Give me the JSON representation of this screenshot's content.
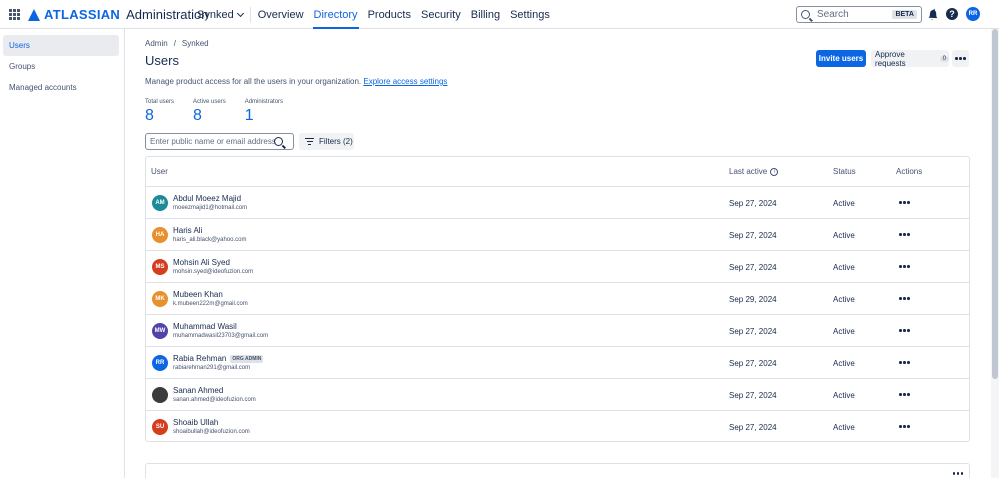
{
  "header": {
    "brand": "ATLASSIAN",
    "product": "Administration",
    "org": "Synked",
    "nav": [
      "Overview",
      "Directory",
      "Products",
      "Security",
      "Billing",
      "Settings"
    ],
    "active_nav": "Directory",
    "search_placeholder": "Search",
    "search_badge": "BETA",
    "profile_initials": "RR"
  },
  "sidebar": {
    "items": [
      {
        "label": "Users",
        "active": true
      },
      {
        "label": "Groups",
        "active": false
      },
      {
        "label": "Managed accounts",
        "active": false
      }
    ]
  },
  "main": {
    "breadcrumb": [
      "Admin",
      "/",
      "Synked"
    ],
    "title": "Users",
    "description": "Manage product access for all the users in your organization.",
    "description_link": "Explore access settings",
    "invite_button": "Invite users",
    "approve_button": "Approve requests",
    "approve_count": "0",
    "stats": [
      {
        "label": "Total users",
        "value": "8"
      },
      {
        "label": "Active users",
        "value": "8"
      },
      {
        "label": "Administrators",
        "value": "1"
      }
    ],
    "filter_placeholder": "Enter public name or email address",
    "filters_button": "Filters (2)"
  },
  "table": {
    "columns": {
      "user": "User",
      "last_active": "Last active",
      "status": "Status",
      "actions": "Actions"
    },
    "info_glyph": "i",
    "rows": [
      {
        "initials": "AM",
        "color": "#1d8a99",
        "name": "Abdul Moeez Majid",
        "email": "moeezmajid1@hotmail.com",
        "last_active": "Sep 27, 2024",
        "status": "Active",
        "badge": ""
      },
      {
        "initials": "HA",
        "color": "#e8902e",
        "name": "Haris Ali",
        "email": "haris_ali.black@yahoo.com",
        "last_active": "Sep 27, 2024",
        "status": "Active",
        "badge": ""
      },
      {
        "initials": "MS",
        "color": "#d43d1f",
        "name": "Mohsin Ali Syed",
        "email": "mohsin.syed@ideofuzion.com",
        "last_active": "Sep 27, 2024",
        "status": "Active",
        "badge": ""
      },
      {
        "initials": "MK",
        "color": "#e8902e",
        "name": "Mubeen Khan",
        "email": "k.mubeen222m@gmail.com",
        "last_active": "Sep 29, 2024",
        "status": "Active",
        "badge": ""
      },
      {
        "initials": "MW",
        "color": "#5243aa",
        "name": "Muhammad Wasil",
        "email": "muhammadwasil23703@gmail.com",
        "last_active": "Sep 27, 2024",
        "status": "Active",
        "badge": ""
      },
      {
        "initials": "RR",
        "color": "#0c66e4",
        "name": "Rabia Rehman",
        "email": "rabiarehman291@gmail.com",
        "last_active": "Sep 27, 2024",
        "status": "Active",
        "badge": "ORG ADMIN"
      },
      {
        "initials": "",
        "color": "#3b3b3b",
        "name": "Sanan Ahmed",
        "email": "sanan.ahmed@ideofuzion.com",
        "last_active": "Sep 27, 2024",
        "status": "Active",
        "badge": ""
      },
      {
        "initials": "SU",
        "color": "#d43d1f",
        "name": "Shoaib Ullah",
        "email": "shoaibullah@ideofuzion.com",
        "last_active": "Sep 27, 2024",
        "status": "Active",
        "badge": ""
      }
    ]
  }
}
